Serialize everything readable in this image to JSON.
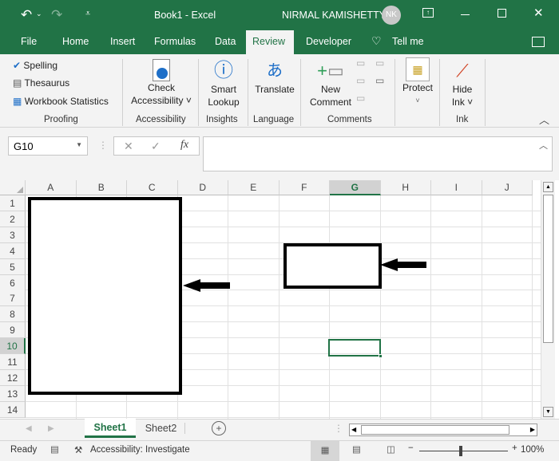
{
  "titlebar": {
    "title": "Book1  -  Excel",
    "user": "NIRMAL KAMISHETTY",
    "initials": "NK"
  },
  "tabs": [
    "File",
    "Home",
    "Insert",
    "Formulas",
    "Data",
    "Review",
    "Developer",
    "Tell me"
  ],
  "ribbon": {
    "proofing": {
      "spelling": "Spelling",
      "thesaurus": "Thesaurus",
      "stats": "Workbook Statistics",
      "label": "Proofing"
    },
    "accessibility": {
      "btn1": "Check",
      "btn2": "Accessibility",
      "label": "Accessibility"
    },
    "insights": {
      "btn1": "Smart",
      "btn2": "Lookup",
      "label": "Insights"
    },
    "language": {
      "btn": "Translate",
      "label": "Language"
    },
    "comments": {
      "btn1": "New",
      "btn2": "Comment",
      "label": "Comments"
    },
    "protect": {
      "btn": "Protect"
    },
    "ink": {
      "btn1": "Hide",
      "btn2": "Ink",
      "label": "Ink"
    }
  },
  "formula": {
    "namebox": "G10",
    "value": ""
  },
  "columns": [
    "A",
    "B",
    "C",
    "D",
    "E",
    "F",
    "G",
    "H",
    "I",
    "J"
  ],
  "rows": [
    "1",
    "2",
    "3",
    "4",
    "5",
    "6",
    "7",
    "8",
    "9",
    "10",
    "11",
    "12",
    "13",
    "14"
  ],
  "selected_cell": "G10",
  "sheets": [
    "Sheet1",
    "Sheet2"
  ],
  "active_sheet": "Sheet1",
  "status": {
    "ready": "Ready",
    "accessibility": "Accessibility: Investigate",
    "zoom": "100%"
  }
}
